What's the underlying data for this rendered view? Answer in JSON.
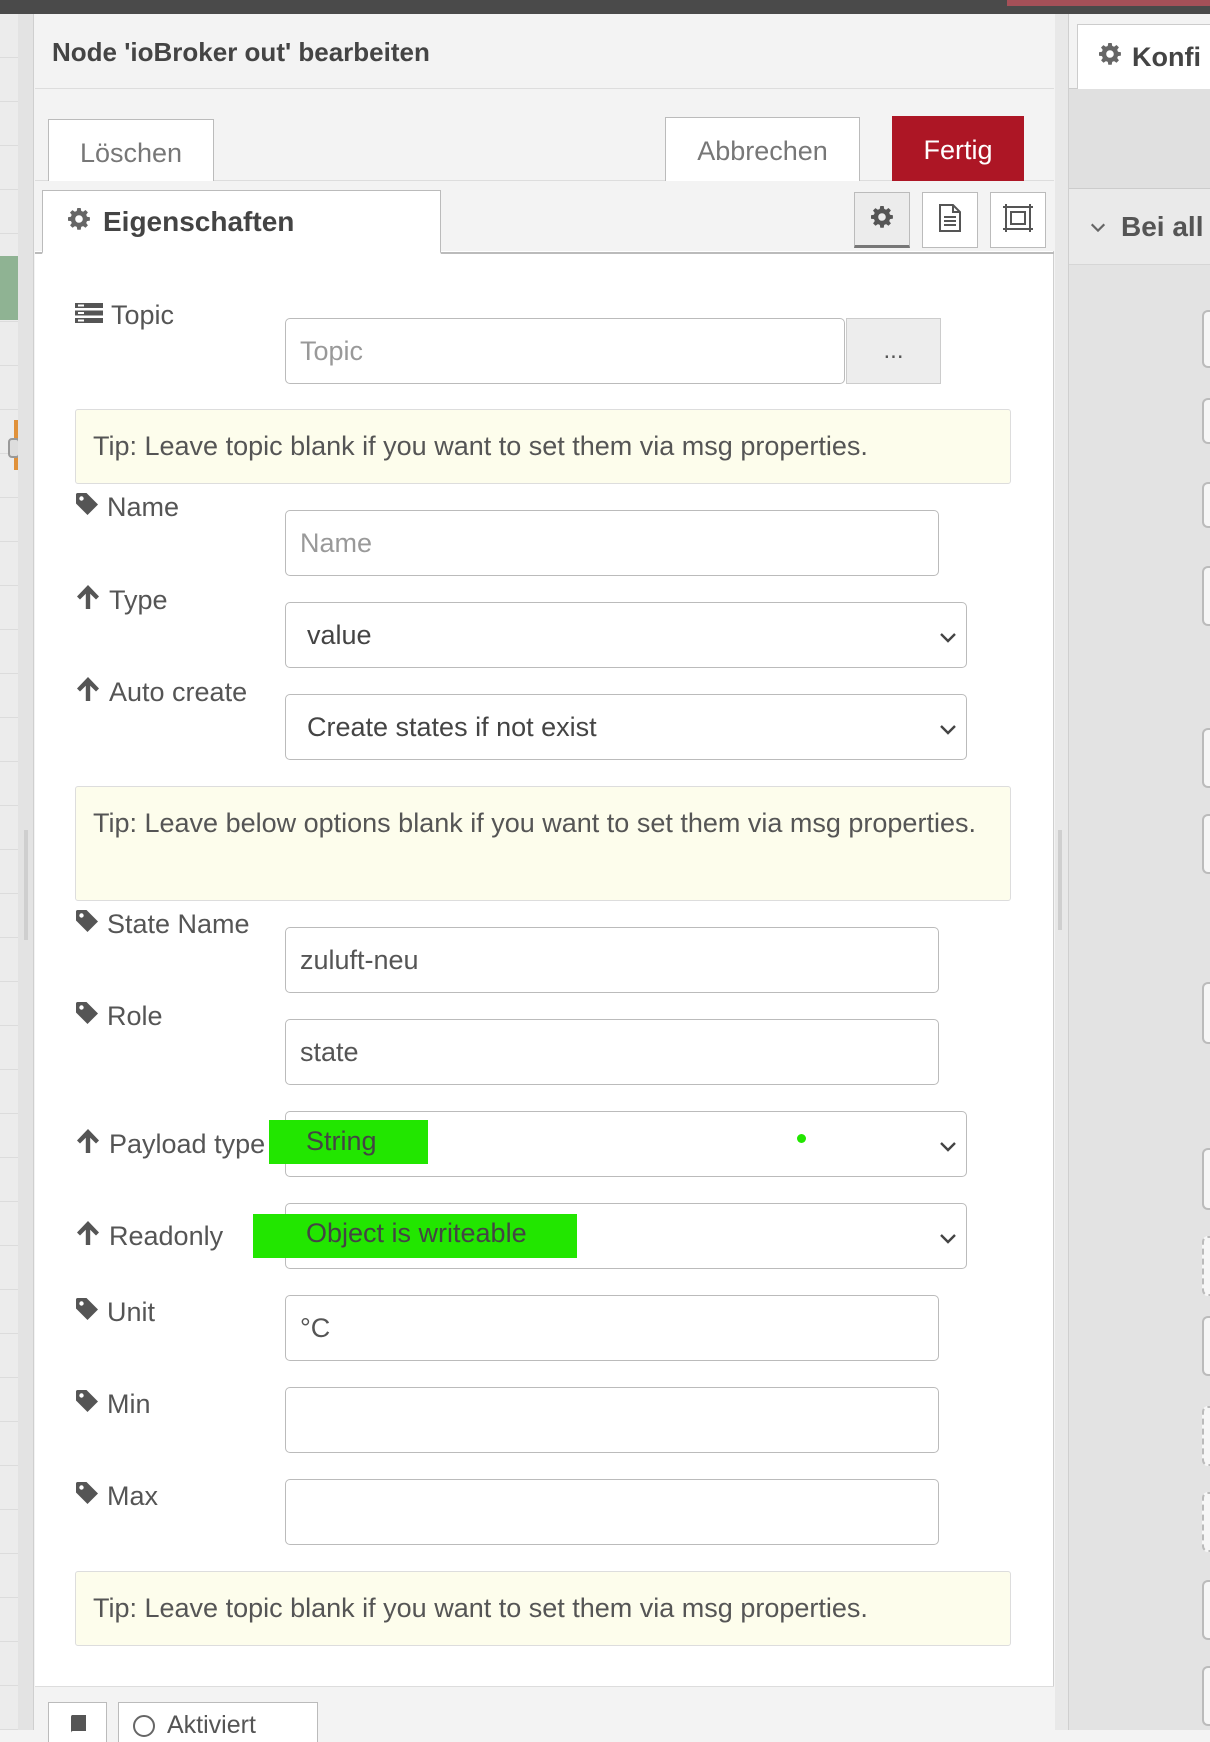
{
  "dialog": {
    "title": "Node 'ioBroker out' bearbeiten",
    "delete_label": "Löschen",
    "cancel_label": "Abbrechen",
    "done_label": "Fertig"
  },
  "tabs": {
    "properties_label": "Eigenschaften"
  },
  "form": {
    "topic": {
      "label": "Topic",
      "placeholder": "Topic",
      "button_label": "..."
    },
    "tip1": "Tip: Leave topic blank if you want to set them via msg properties.",
    "name": {
      "label": "Name",
      "placeholder": "Name"
    },
    "type": {
      "label": "Type",
      "value": "value"
    },
    "auto_create": {
      "label": "Auto create",
      "value": "Create states if not exist"
    },
    "tip2": "Tip: Leave below options blank if you want to set them via msg properties.",
    "state_name": {
      "label": "State Name",
      "value": "zuluft-neu"
    },
    "role": {
      "label": "Role",
      "value": "state"
    },
    "payload_type": {
      "label": "Payload type",
      "value": "String"
    },
    "readonly": {
      "label": "Readonly",
      "value": "Object is writeable"
    },
    "unit": {
      "label": "Unit",
      "value": "°C"
    },
    "min": {
      "label": "Min",
      "value": ""
    },
    "max": {
      "label": "Max",
      "value": ""
    },
    "tip3": "Tip: Leave topic blank if you want to set them via msg properties."
  },
  "footer": {
    "enabled_label": "Aktiviert"
  },
  "sidebar": {
    "tab_label": "Konfi",
    "section_label": "Bei all"
  },
  "icons": {
    "gear": "gear-icon",
    "tag": "tag-icon",
    "arrow_up": "arrow-up-icon",
    "list": "list-icon",
    "chevron": "chevron-down-icon",
    "document": "document-icon",
    "frame": "frame-icon",
    "book": "book-icon"
  },
  "colors": {
    "done_button": "#ad1625",
    "tip_background": "#fdfdec",
    "highlight": "#22e600"
  }
}
